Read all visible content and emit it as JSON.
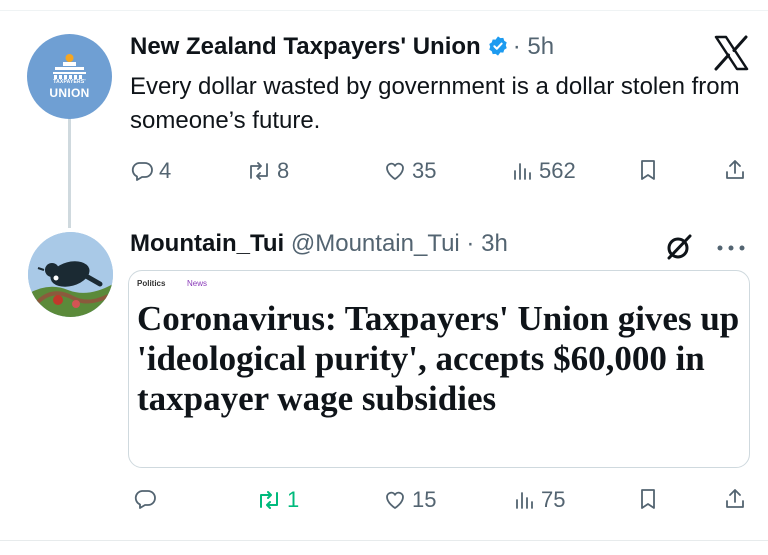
{
  "post1": {
    "display_name": "New Zealand Taxpayers' Union",
    "separator_time": "· 5h",
    "text": "Every dollar wasted by government is a dollar stolen from someone’s future.",
    "avatar": {
      "line_small": "TAXPAYERS'",
      "line_big": "UNION"
    },
    "stats": {
      "replies": "4",
      "reposts": "8",
      "likes": "35",
      "views": "562"
    },
    "icons": [
      "x-logo-icon",
      "verified-badge-icon",
      "reply-icon",
      "repost-icon",
      "like-icon",
      "views-icon",
      "bookmark-icon",
      "share-icon"
    ]
  },
  "post2": {
    "display_name": "Mountain_Tui",
    "handle_time": "@Mountain_Tui · 3h",
    "stats": {
      "replies": "",
      "reposts": "1",
      "likes": "15",
      "views": "75"
    },
    "card": {
      "tag_section": "Politics",
      "tag_category": "News",
      "headline": "Coronavirus: Taxpayers' Union gives up 'ideological purity', accepts $60,000 in taxpayer wage subsidies"
    },
    "icons": [
      "grok-icon",
      "more-icon",
      "reply-icon",
      "repost-icon",
      "like-icon",
      "views-icon",
      "bookmark-icon",
      "share-icon"
    ]
  },
  "colors": {
    "text": "#0f1419",
    "muted": "#536471",
    "verified": "#1d9bf0",
    "repost_active": "#00ba7c",
    "avatar_blue": "#6f9fd3"
  }
}
